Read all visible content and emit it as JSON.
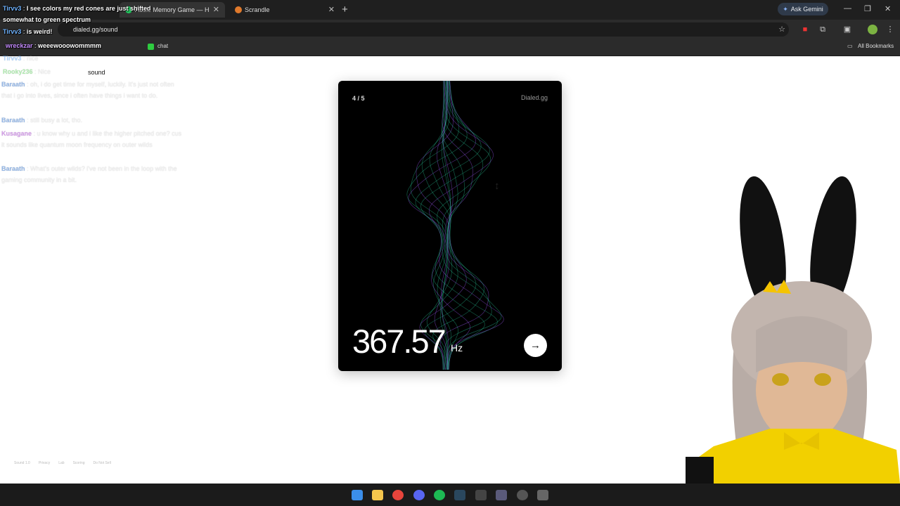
{
  "browser": {
    "tabs": [
      {
        "label": "Audio Memory Game — H",
        "active": true
      },
      {
        "label": "Scrandle",
        "active": false
      }
    ],
    "new_tab_symbol": "+",
    "gemini_label": "Ask Gemini",
    "url": "dialed.gg/sound",
    "bookmarks": [
      "chat"
    ],
    "all_bookmarks_label": "All Bookmarks"
  },
  "page": {
    "site_label": "sound",
    "footer_links": [
      "Sound 1.0",
      "Privacy",
      "Lab",
      "Scoring",
      "Do Not Sell"
    ]
  },
  "card": {
    "progress": "4 / 5",
    "brand": "Dialed.gg",
    "frequency": "367.57",
    "unit": "Hz",
    "next_icon": "arrow-right-icon"
  },
  "chat_overlay": [
    {
      "user": "Tirvv3",
      "text": "I see colors my red cones are just shifted somewhat to green spectrum"
    },
    {
      "user": "Tirvv3",
      "text": "is weird!"
    },
    {
      "user": "wreckzar",
      "text": "weeewooowommmm"
    },
    {
      "user": "Tirvv3",
      "text": "nice"
    },
    {
      "user": "Rooky236",
      "text": "Nice"
    },
    {
      "user": "Baraath",
      "text": "oh, i do get time for myself, luckily. It's just not often that i go into lives, since i often have things i want to do."
    },
    {
      "user": "Baraath",
      "text": "still busy a lot, tho."
    },
    {
      "user": "Kusagane",
      "text": "u know why u and i like the higher pitched one? cus it sounds like quantum moon frequency on outer wilds"
    },
    {
      "user": "Baraath",
      "text": "What's outer wilds? i've not been in the loop with the gaming community in a bit."
    }
  ],
  "colors": {
    "accent_teal": "#2fe3b0",
    "accent_purple": "#8a4dd8",
    "chrome_bg": "#1f1f1f"
  }
}
